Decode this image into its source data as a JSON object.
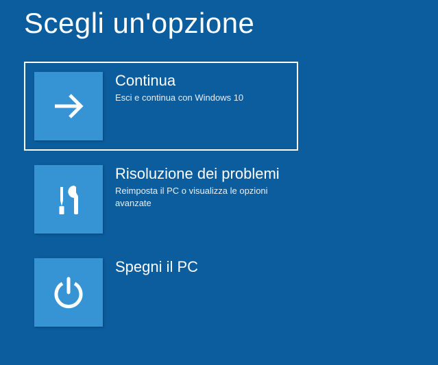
{
  "title": "Scegli un'opzione",
  "options": [
    {
      "title": "Continua",
      "subtitle": "Esci e continua con Windows 10"
    },
    {
      "title": "Risoluzione dei problemi",
      "subtitle": "Reimposta il PC o visualizza le opzioni avanzate"
    },
    {
      "title": "Spegni il PC",
      "subtitle": ""
    }
  ]
}
